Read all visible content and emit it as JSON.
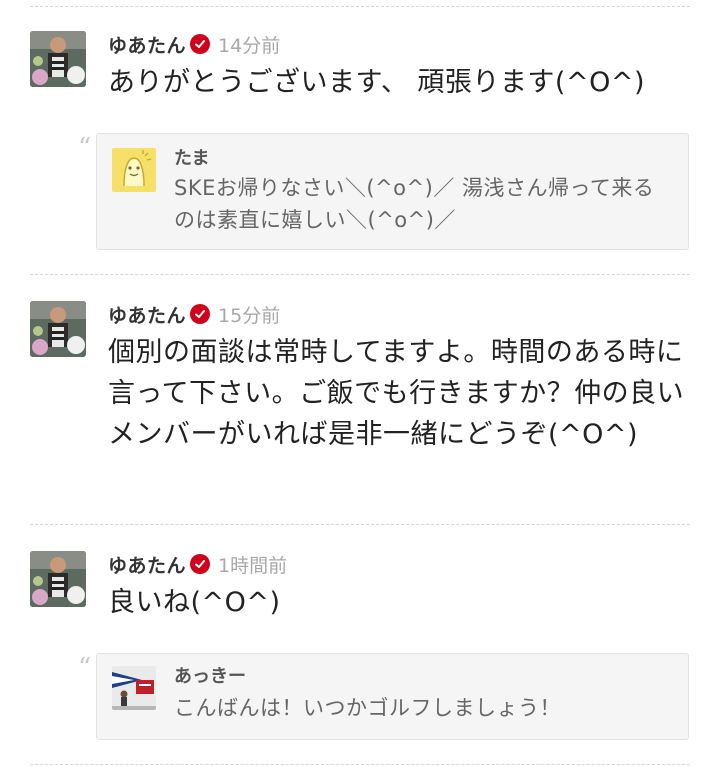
{
  "colors": {
    "verified_badge": "#d0021b",
    "timestamp": "#a8a8a8",
    "quote_background": "#f5f5f5"
  },
  "comments": [
    {
      "author": "ゆあたん",
      "verified_icon": "check-badge-icon",
      "time": "14分前",
      "text": "ありがとうございます、 頑張ります(^O^)",
      "reply_to": {
        "author": "たま",
        "avatar_icon": "yellow-character-icon",
        "text": "SKEお帰りなさい＼(^o^)／ 湯浅さん帰って来るのは素直に嬉しい＼(^o^)／"
      }
    },
    {
      "author": "ゆあたん",
      "verified_icon": "check-badge-icon",
      "time": "15分前",
      "text": "個別の面談は常時してますよ。時間のある時に言って下さい。ご飯でも行きますか？仲の良いメンバーがいれば是非一緒にどうぞ(^O^)"
    },
    {
      "author": "ゆあたん",
      "verified_icon": "check-badge-icon",
      "time": "1時間前",
      "text": "良いね(^O^)",
      "reply_to": {
        "author": "あっきー",
        "avatar_icon": "photo-thumbnail-icon",
        "text": "こんばんは！いつかゴルフしましょう！"
      }
    }
  ]
}
